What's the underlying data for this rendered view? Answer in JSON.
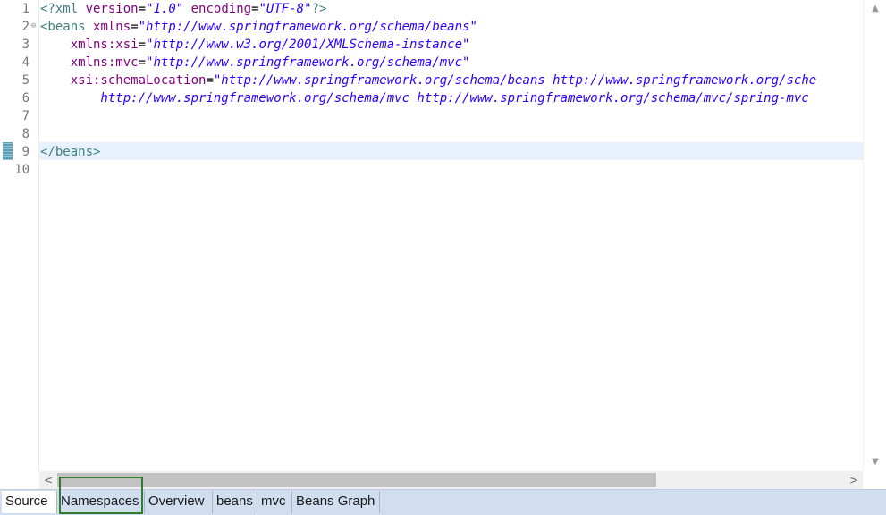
{
  "editor": {
    "line_numbers": [
      "1",
      "2",
      "3",
      "4",
      "5",
      "6",
      "7",
      "8",
      "9",
      "10"
    ],
    "lines": [
      [
        {
          "t": "pi",
          "v": "<?xml "
        },
        {
          "t": "attr",
          "v": "version"
        },
        {
          "t": "plain",
          "v": "="
        },
        {
          "t": "val",
          "v": "\"1.0\""
        },
        {
          "t": "plain",
          "v": " "
        },
        {
          "t": "attr",
          "v": "encoding"
        },
        {
          "t": "plain",
          "v": "="
        },
        {
          "t": "val",
          "v": "\"UTF-8\""
        },
        {
          "t": "pi",
          "v": "?>"
        }
      ],
      [
        {
          "t": "tag",
          "v": "<beans "
        },
        {
          "t": "attr",
          "v": "xmlns"
        },
        {
          "t": "plain",
          "v": "="
        },
        {
          "t": "val",
          "v": "\"http://www.springframework.org/schema/beans\""
        }
      ],
      [
        {
          "t": "plain",
          "v": "    "
        },
        {
          "t": "attr",
          "v": "xmlns:xsi"
        },
        {
          "t": "plain",
          "v": "="
        },
        {
          "t": "val",
          "v": "\"http://www.w3.org/2001/XMLSchema-instance\""
        }
      ],
      [
        {
          "t": "plain",
          "v": "    "
        },
        {
          "t": "attr",
          "v": "xmlns:mvc"
        },
        {
          "t": "plain",
          "v": "="
        },
        {
          "t": "val",
          "v": "\"http://www.springframework.org/schema/mvc\""
        }
      ],
      [
        {
          "t": "plain",
          "v": "    "
        },
        {
          "t": "attr",
          "v": "xsi:schemaLocation"
        },
        {
          "t": "plain",
          "v": "="
        },
        {
          "t": "val",
          "v": "\"http://www.springframework.org/schema/beans http://www.springframework.org/sche"
        }
      ],
      [
        {
          "t": "val",
          "v": "        http://www.springframework.org/schema/mvc http://www.springframework.org/schema/mvc/spring-mvc"
        }
      ],
      [],
      [],
      [
        {
          "t": "tag",
          "v": "</beans>"
        }
      ],
      []
    ],
    "fold_icon": "fold-minus-icon",
    "current_line": "9"
  },
  "scrollbars": {
    "up_arrow": "▲",
    "down_arrow": "▼",
    "left_arrow": "<",
    "right_arrow": ">",
    "horizontal_thumb_fraction": 0.76
  },
  "tabs": [
    {
      "id": "source",
      "label": "Source"
    },
    {
      "id": "namespaces",
      "label": "Namespaces"
    },
    {
      "id": "overview",
      "label": "Overview"
    },
    {
      "id": "beans",
      "label": "beans"
    },
    {
      "id": "mvc",
      "label": "mvc"
    },
    {
      "id": "beans-graph",
      "label": "Beans Graph"
    }
  ],
  "active_tab": "source",
  "focused_tab": "namespaces",
  "colors": {
    "tag": "#3f7f7f",
    "attribute": "#7f007f",
    "value": "#2a00ff",
    "current_line": "#e8f2fe",
    "tab_bar": "#d0def0",
    "focus_outline": "#2e7d32"
  }
}
